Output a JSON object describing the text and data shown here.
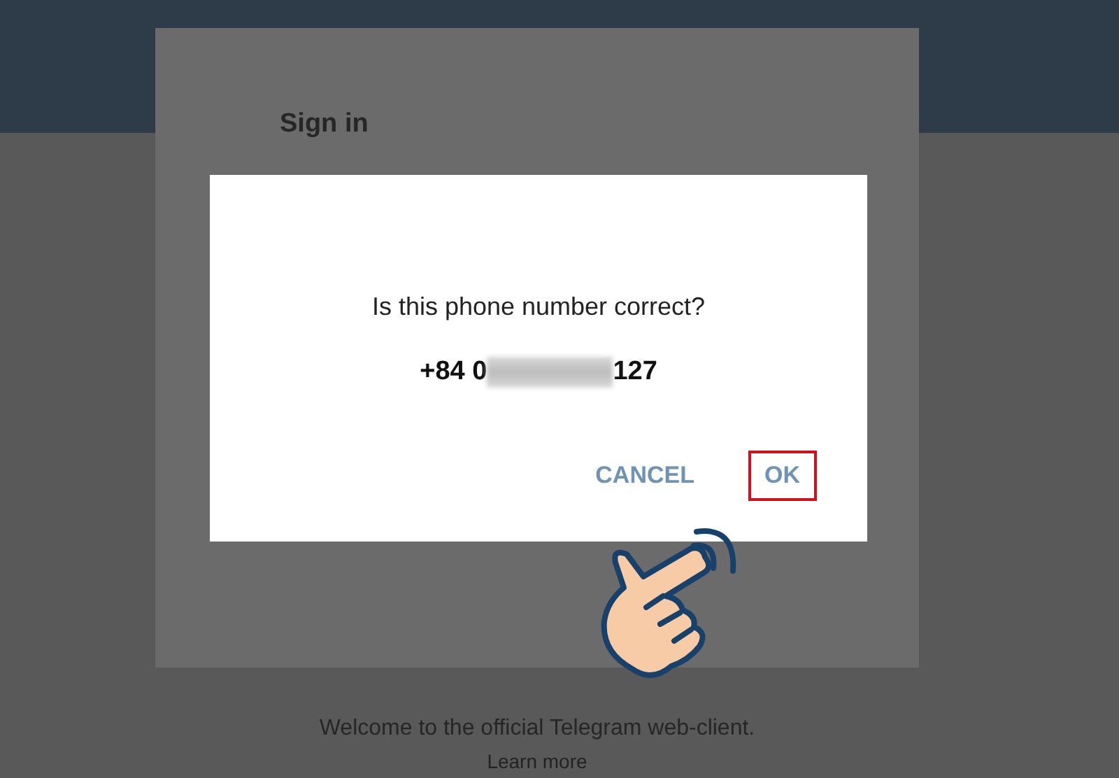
{
  "card": {
    "title": "Sign in"
  },
  "dialog": {
    "question": "Is this phone number correct?",
    "phone_prefix": "+84 0",
    "phone_suffix": "127",
    "buttons": [
      {
        "label": "CANCEL",
        "highlighted": false
      },
      {
        "label": "OK",
        "highlighted": true
      }
    ]
  },
  "footer": {
    "welcome": "Welcome to the official Telegram web-client.",
    "link": "Learn more"
  }
}
